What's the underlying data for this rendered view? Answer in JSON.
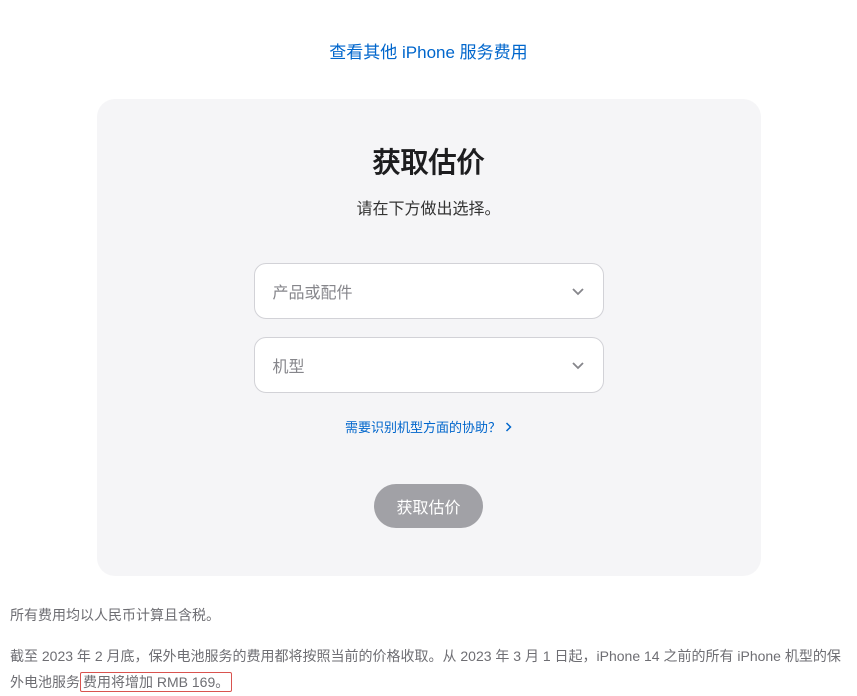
{
  "topLink": {
    "label": "查看其他 iPhone 服务费用"
  },
  "card": {
    "title": "获取估价",
    "subtitle": "请在下方做出选择。",
    "dropdown1": {
      "placeholder": "产品或配件"
    },
    "dropdown2": {
      "placeholder": "机型"
    },
    "helpLink": {
      "label": "需要识别机型方面的协助？"
    },
    "submitButton": {
      "label": "获取估价"
    }
  },
  "footer": {
    "para1": "所有费用均以人民币计算且含税。",
    "para2_pre": "截至 2023 年 2 月底，保外电池服务的费用都将按照当前的价格收取。从 2023 年 3 月 1 日起，iPhone 14 之前的所有 iPhone 机型的保外电池服务",
    "para2_highlight": "费用将增加 RMB 169。"
  }
}
